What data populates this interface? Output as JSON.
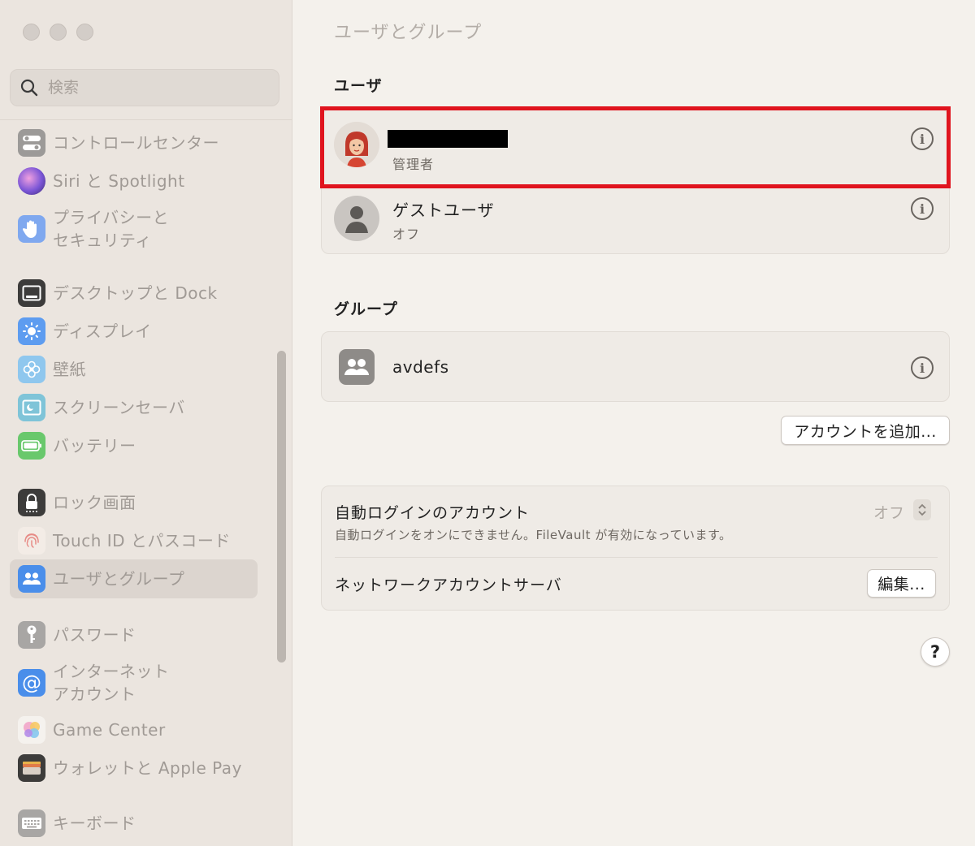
{
  "window": {
    "title": "ユーザとグループ"
  },
  "search": {
    "placeholder": "検索"
  },
  "sidebar": {
    "items": [
      {
        "label": "コントロールセンター",
        "icon": "control-center-icon"
      },
      {
        "label": "Siri と Spotlight",
        "icon": "siri-icon"
      },
      {
        "label": "プライバシーと\nセキュリティ",
        "icon": "privacy-hand-icon"
      },
      {
        "label": "デスクトップと Dock",
        "icon": "desktop-dock-icon"
      },
      {
        "label": "ディスプレイ",
        "icon": "display-brightness-icon"
      },
      {
        "label": "壁紙",
        "icon": "wallpaper-flower-icon"
      },
      {
        "label": "スクリーンセーバ",
        "icon": "screensaver-icon"
      },
      {
        "label": "バッテリー",
        "icon": "battery-icon"
      },
      {
        "label": "ロック画面",
        "icon": "lock-screen-icon"
      },
      {
        "label": "Touch ID とパスコード",
        "icon": "fingerprint-icon"
      },
      {
        "label": "ユーザとグループ",
        "icon": "users-groups-icon",
        "active": true
      },
      {
        "label": "パスワード",
        "icon": "key-icon"
      },
      {
        "label": "インターネット\nアカウント",
        "icon": "at-sign-icon"
      },
      {
        "label": "Game Center",
        "icon": "game-center-icon"
      },
      {
        "label": "ウォレットと Apple Pay",
        "icon": "wallet-icon"
      },
      {
        "label": "キーボード",
        "icon": "keyboard-icon"
      }
    ]
  },
  "users_section": {
    "label": "ユーザ",
    "users": [
      {
        "name": "",
        "role": "管理者",
        "name_redacted": true
      },
      {
        "name": "ゲストユーザ",
        "role": "オフ"
      }
    ]
  },
  "groups_section": {
    "label": "グループ",
    "groups": [
      {
        "name": "avdefs"
      }
    ]
  },
  "add_account_button": "アカウントを追加...",
  "auto_login": {
    "title": "自動ログインのアカウント",
    "description": "自動ログインをオンにできません。FileVault が有効になっています。",
    "value": "オフ"
  },
  "network_server": {
    "title": "ネットワークアカウントサーバ",
    "button": "編集..."
  },
  "help_button": "?",
  "colors": {
    "highlight": "#e0141e",
    "sidebar_bg": "#ebe5df",
    "main_bg": "#f4f1ec"
  }
}
